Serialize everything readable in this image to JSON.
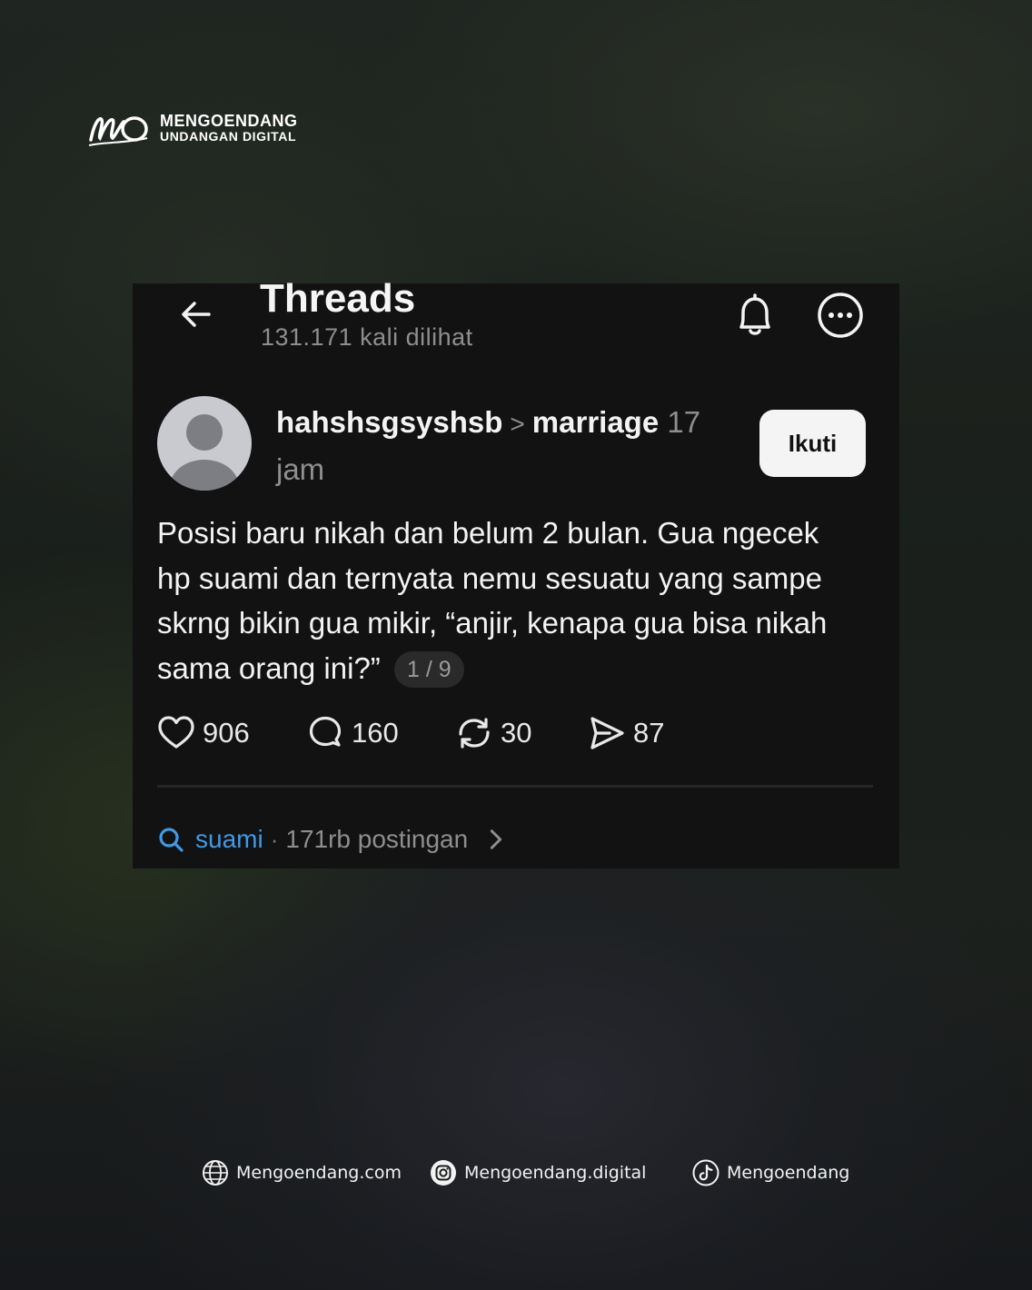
{
  "brand": {
    "name": "MENGOENDANG",
    "tagline": "UNDANGAN DIGITAL"
  },
  "header": {
    "title": "Threads",
    "views": "131.171 kali dilihat"
  },
  "post": {
    "username": "hahshsgsyshsb",
    "separator": ">",
    "topic": "marriage",
    "time": "17 jam",
    "follow_label": "Ikuti",
    "text": "Posisi baru nikah dan belum 2 bulan. Gua ngecek hp suami dan ternyata nemu sesuatu yang sampe skrng bikin gua mikir, “anjir, kenapa gua bisa nikah sama orang ini?”",
    "pager": "1 / 9",
    "likes": "906",
    "replies": "160",
    "reposts": "30",
    "shares": "87"
  },
  "search": {
    "tag": "suami",
    "separator": "·",
    "count": "171rb postingan"
  },
  "footer": {
    "website": "Mengoendang.com",
    "instagram": "Mengoendang.digital",
    "tiktok": "Mengoendang"
  },
  "icons": [
    "back-arrow-icon",
    "bell-icon",
    "more-icon",
    "heart-icon",
    "comment-icon",
    "repost-icon",
    "share-icon",
    "search-icon",
    "chevron-right-icon",
    "globe-icon",
    "instagram-icon",
    "tiktok-icon"
  ]
}
